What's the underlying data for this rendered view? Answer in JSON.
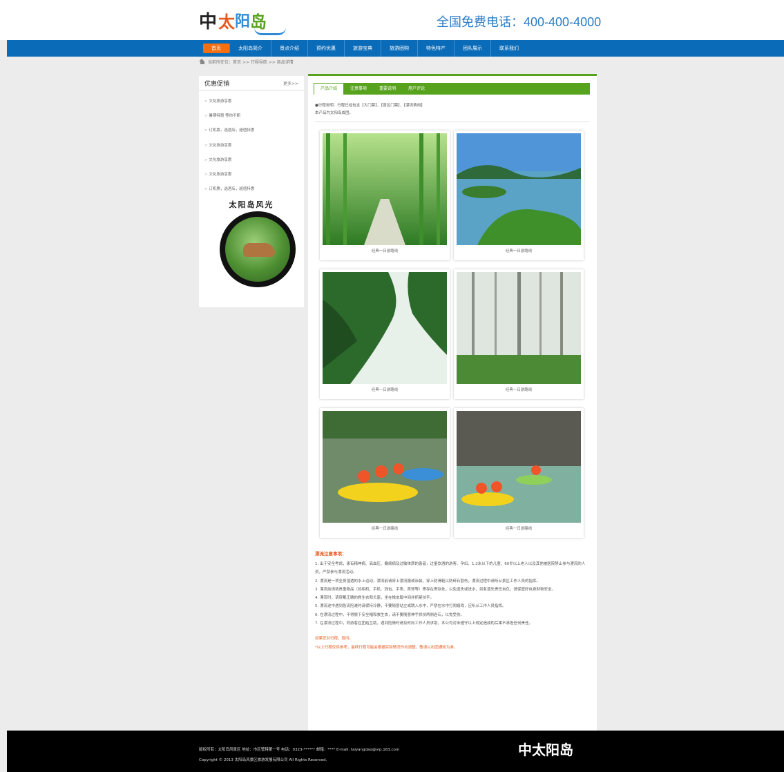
{
  "header": {
    "logo": {
      "mark": "中",
      "chars": [
        "太",
        "阳",
        "岛"
      ]
    },
    "hotline": "全国免费电话：400-400-4000"
  },
  "nav": {
    "items": [
      "首页",
      "太阳岛简介",
      "景点介绍",
      "预约优惠",
      "旅游宝典",
      "旅游团购",
      "特色特产",
      "团队展示",
      "联系我们"
    ]
  },
  "breadcrumb": "当前所在位：首页 >> 行程导航 >> 商品详情",
  "sidebar": {
    "title": "优惠促销",
    "more": "更多>>",
    "items": [
      "文化旅游享惠",
      "暑期特惠 等你不断",
      "订机票，选酒店，超值特惠",
      "文化旅游享惠",
      "文化旅游享惠",
      "文化旅游享惠",
      "订机票，选酒店，超值特惠"
    ],
    "badge_title": "太阳岛风光"
  },
  "main": {
    "tabs": [
      "产品介绍",
      "注意事项",
      "重要说明",
      "用户评论"
    ],
    "intro_line1": "●行程说明：行程已经包含【大门票】、【景区门票】、【漂流费用】",
    "intro_line2": "本产品为太阳岛成团。",
    "photos": [
      {
        "caption": "经典一日游路线"
      },
      {
        "caption": "经典一日游路线"
      },
      {
        "caption": "经典一日游路线"
      },
      {
        "caption": "经典一日游路线"
      },
      {
        "caption": "经典一日游路线"
      },
      {
        "caption": "经典一日游路线"
      }
    ],
    "notes_title": "漂流注意事项：",
    "notes": [
      "1. 出于安全考虑，患有精神病、高血压、癫痫病及过敏体质的患者，过量饮酒的游客、孕妇、1.2米以下的儿童、60岁以上老人以及其他被医院禁止参与漂流的人员，严禁参与漂流活动。",
      "2. 漂流是一项全身湿透的水上运动，漂流前请穿上漂流服或泳装，穿上防滑鞋以防碎石割伤，漂流过程中请听从景区工作人员的指挥。",
      "3. 漂流前请将贵重物品（如相机、手机、钱包、手表、首饰等）寄存在寄存处，以免遗失或进水，如有遗失责任自负，请保管好自身财物安全。",
      "4. 漂流时，请穿戴正确的救生衣和头盔，坐在橡皮艇中间并抓紧扶手。",
      "5. 漂流途中遇到急流险滩时请保持冷静，不要随意站立或跳入水中，严禁在水中打闹嬉戏，应听从工作人员指挥。",
      "6. 在漂流过程中，不得脱下安全帽和救生衣，请不要随意伸手抓扶两侧岩石，以免受伤。",
      "7. 在漂流过程中，同游客应团结互助，遇到险情时请及时向工作人员求助，本公司对未遵守以上规定造成的后果不承担任何责任。"
    ],
    "note_red1": "如果您对行程，提问。",
    "note_red2": "*以上行程仅供参考，最终行程可能会根据实际情况作出调整，敬请以出团通知为准。"
  },
  "footer": {
    "line1": "版权所有：太阳岛风景区  地址：市区管辖第一号  电话：0323-******  邮箱：****  E-mail: taiyangdao@vip.163.com",
    "line2": "Copyright © 2013 太阳岛风景区旅游发展有限公司 All Rights Reserved."
  },
  "colors": {
    "nav_blue": "#0a6bb8",
    "nav_active": "#f36f12",
    "tab_green": "#58a31e",
    "accent_orange": "#e8591d"
  }
}
